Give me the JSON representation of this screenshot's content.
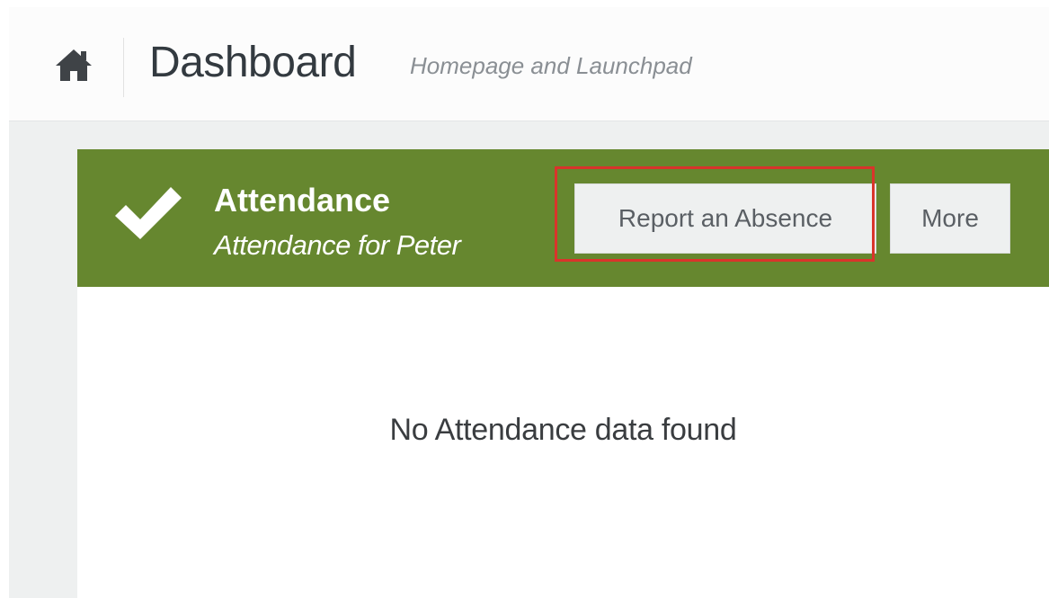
{
  "header": {
    "home_icon": "home-icon",
    "title": "Dashboard",
    "subtitle": "Homepage and Launchpad"
  },
  "widget": {
    "icon": "checkmark-icon",
    "title": "Attendance",
    "subtitle": "Attendance for Peter",
    "buttons": {
      "report_absence": "Report an Absence",
      "more": "More"
    },
    "empty_message": "No Attendance data found"
  },
  "colors": {
    "widget_header": "#66872f",
    "highlight": "#d9342b",
    "title_text": "#333a40"
  }
}
